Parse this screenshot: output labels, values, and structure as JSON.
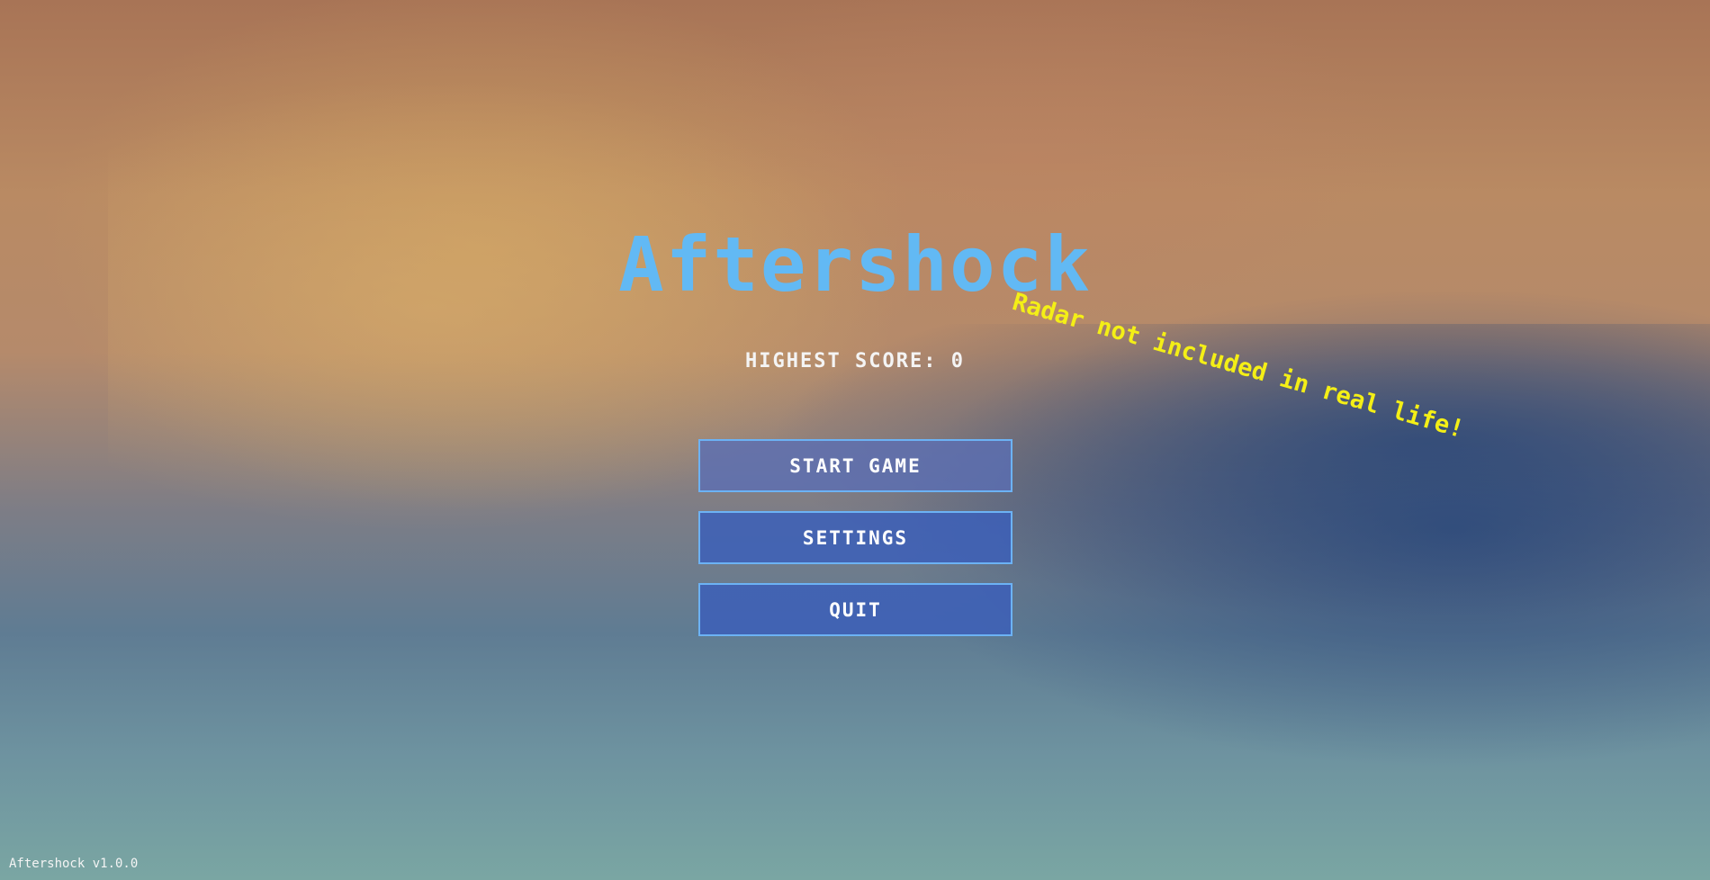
{
  "game": {
    "title": "Aftershock",
    "tagline": "Radar not included in real life!",
    "highest_score_label": "HIGHEST SCORE: 0",
    "version": "Aftershock v1.0.0"
  },
  "menu": {
    "start_label": "START GAME",
    "settings_label": "SETTINGS",
    "quit_label": "QUIT"
  },
  "colors": {
    "title": "#62b9f4",
    "tagline": "#f4ef16",
    "button_border": "#6cb2f4"
  }
}
